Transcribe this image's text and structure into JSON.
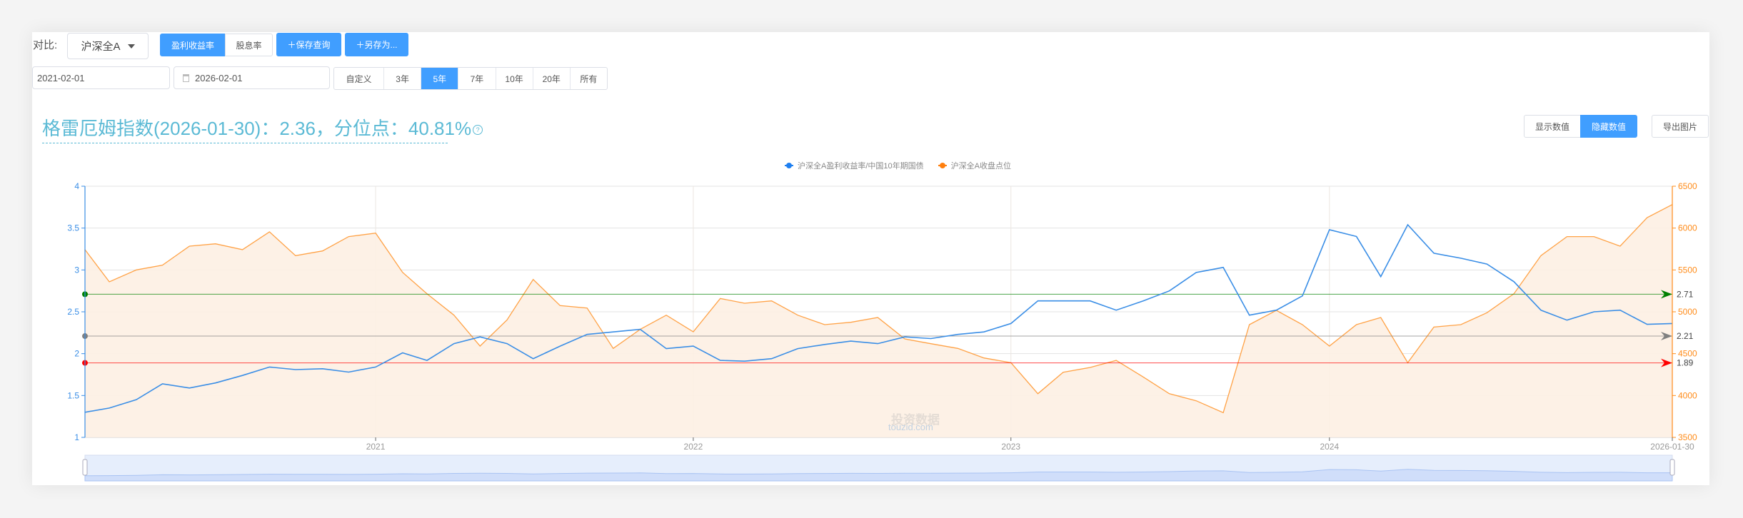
{
  "toolbar": {
    "compare_label": "对比:",
    "index_select": "沪深全A",
    "metric_tabs": [
      {
        "label": "盈利收益率",
        "active": true
      },
      {
        "label": "股息率",
        "active": false
      }
    ],
    "save_query": "＋保存查询",
    "save_as": "＋另存为..."
  },
  "date_range": {
    "start": "2021-02-01",
    "end": "2026-02-01",
    "periods": [
      {
        "label": "自定义",
        "active": false
      },
      {
        "label": "3年",
        "active": false
      },
      {
        "label": "5年",
        "active": true
      },
      {
        "label": "7年",
        "active": false
      },
      {
        "label": "10年",
        "active": false
      },
      {
        "label": "20年",
        "active": false
      },
      {
        "label": "所有",
        "active": false
      }
    ]
  },
  "headline": {
    "text": "格雷厄姆指数(2026-01-30)：2.36，分位点：40.81%",
    "help_icon": "question-circle-icon"
  },
  "actions": {
    "show_values": "显示数值",
    "hide_values": "隐藏数值",
    "hide_active": true,
    "export_image": "导出图片"
  },
  "watermark": {
    "line1": "投资数据",
    "line2": "touzid.com"
  },
  "colors": {
    "accent": "#409eff",
    "blue_series": "#3a8ee6",
    "orange_series": "#ff8c1a",
    "area_fill": "#fdf0e3"
  },
  "chart_data": {
    "type": "line",
    "legend": [
      "沪深全A盈利收益率/中国10年期国债",
      "沪深全A收盘点位"
    ],
    "legend_placement": "top-center",
    "grid": true,
    "x": [
      "2021-02-01",
      "2021-03-01",
      "2021-04-01",
      "2021-05-01",
      "2021-06-01",
      "2021-07-01",
      "2021-08-01",
      "2021-09-01",
      "2021-10-01",
      "2021-11-01",
      "2021-12-01",
      "2022-01-01",
      "2022-02-01",
      "2022-03-01",
      "2022-04-01",
      "2022-05-01",
      "2022-06-01",
      "2022-07-01",
      "2022-08-01",
      "2022-09-01",
      "2022-10-01",
      "2022-11-01",
      "2022-12-01",
      "2023-01-01",
      "2023-02-01",
      "2023-03-01",
      "2023-04-01",
      "2023-05-01",
      "2023-06-01",
      "2023-07-01",
      "2023-08-01",
      "2023-09-01",
      "2023-10-01",
      "2023-11-01",
      "2023-12-01",
      "2024-01-01",
      "2024-02-01",
      "2024-03-01",
      "2024-04-01",
      "2024-05-01",
      "2024-06-01",
      "2024-07-01",
      "2024-08-01",
      "2024-09-01",
      "2024-10-01",
      "2024-11-01",
      "2024-12-01",
      "2025-01-01",
      "2025-02-01",
      "2025-03-01",
      "2025-04-01",
      "2025-05-01",
      "2025-06-01",
      "2025-07-01",
      "2025-08-01",
      "2025-09-01",
      "2025-10-01",
      "2025-11-01",
      "2025-12-01",
      "2026-01-01",
      "2026-01-30"
    ],
    "x_ticks": [
      {
        "label": "2021",
        "at": "2022-01-01"
      },
      {
        "label": "2022",
        "at": "2023-01-01"
      },
      {
        "label": "2023",
        "at": "2024-01-01"
      },
      {
        "label": "2024",
        "at": "2025-01-01"
      },
      {
        "label": "2026-01-30",
        "at": "2026-01-30"
      }
    ],
    "y_left": {
      "min": 1,
      "max": 4,
      "ticks": [
        "1",
        "1.5",
        "2",
        "2.5",
        "3",
        "3.5",
        "4"
      ],
      "color": "#3a8ee6"
    },
    "y_right": {
      "min": 3500,
      "max": 6500,
      "ticks": [
        "3500",
        "4000",
        "4500",
        "5000",
        "5500",
        "6000",
        "6500"
      ],
      "color": "#ff8c1a"
    },
    "series": [
      {
        "name": "沪深全A盈利收益率/中国10年期国债",
        "axis": "left",
        "color": "#3a8ee6",
        "values": [
          1.3,
          1.35,
          1.45,
          1.64,
          1.59,
          1.65,
          1.74,
          1.84,
          1.81,
          1.82,
          1.78,
          1.84,
          2.01,
          1.92,
          2.12,
          2.2,
          2.12,
          1.94,
          2.09,
          2.23,
          2.26,
          2.29,
          2.06,
          2.09,
          1.92,
          1.91,
          1.94,
          2.06,
          2.11,
          2.15,
          2.12,
          2.2,
          2.18,
          2.23,
          2.26,
          2.36,
          2.63,
          2.63,
          2.63,
          2.52,
          2.63,
          2.75,
          2.97,
          3.03,
          2.46,
          2.52,
          2.69,
          3.48,
          3.4,
          2.92,
          3.54,
          3.2,
          3.14,
          3.07,
          2.86,
          2.52,
          2.4,
          2.5,
          2.52,
          2.35,
          2.36
        ]
      },
      {
        "name": "沪深全A收盘点位",
        "axis": "right",
        "color": "#ff8c1a",
        "area": true,
        "values": [
          5742,
          5358,
          5500,
          5557,
          5784,
          5812,
          5742,
          5955,
          5671,
          5727,
          5898,
          5940,
          5471,
          5216,
          4960,
          4591,
          4904,
          5386,
          5074,
          5045,
          4563,
          4790,
          4960,
          4761,
          5159,
          5102,
          5130,
          4960,
          4847,
          4875,
          4932,
          4676,
          4619,
          4563,
          4449,
          4392,
          4022,
          4278,
          4335,
          4420,
          4222,
          4022,
          3937,
          3796,
          4847,
          5017,
          4847,
          4591,
          4847,
          4932,
          4392,
          4818,
          4847,
          4989,
          5216,
          5671,
          5898,
          5898,
          5784,
          6125,
          6281
        ]
      }
    ],
    "reference_lines": [
      {
        "value": 2.71,
        "label": "2.71",
        "color": "#008000"
      },
      {
        "value": 2.21,
        "label": "2.21",
        "color": "#808080"
      },
      {
        "value": 1.89,
        "label": "1.89",
        "color": "#ff0000"
      }
    ],
    "data_zoom": {
      "start_percent": 0,
      "end_percent": 100
    }
  }
}
